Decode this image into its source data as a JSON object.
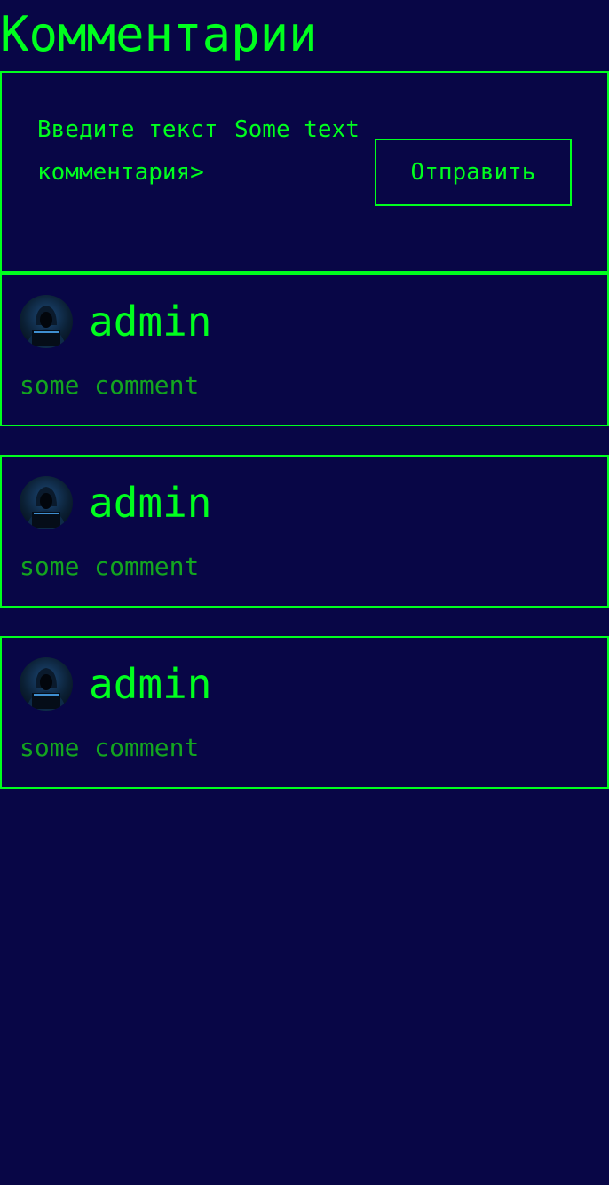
{
  "header": {
    "title": "Комментарии"
  },
  "comment_form": {
    "label": "Введите текст комментария>",
    "input_value": "Some text",
    "send_label": "Отправить"
  },
  "comments": [
    {
      "author": "admin",
      "avatar_icon": "hooded-hacker-avatar",
      "text": "some comment"
    },
    {
      "author": "admin",
      "avatar_icon": "hooded-hacker-avatar",
      "text": "some comment"
    },
    {
      "author": "admin",
      "avatar_icon": "hooded-hacker-avatar",
      "text": "some comment"
    }
  ],
  "colors": {
    "background": "#080646",
    "accent": "#00ff1e",
    "comment_text": "#13a51f"
  }
}
